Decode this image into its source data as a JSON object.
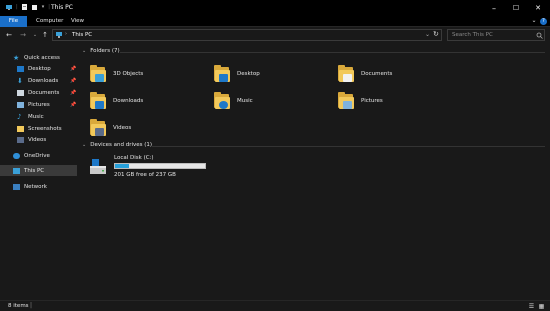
{
  "window": {
    "title": "This PC",
    "controls": {
      "minimize": "–",
      "maximize": "☐",
      "close": "✕"
    }
  },
  "ribbon": {
    "tabs": [
      "File",
      "Computer",
      "View"
    ],
    "expand_icon": "chevron-down-icon",
    "help_icon": "help-icon"
  },
  "address": {
    "path": "This PC",
    "search_placeholder": "Search This PC"
  },
  "sidebar": {
    "items": [
      {
        "label": "Quick access",
        "icon": "star-icon",
        "pinned": false
      },
      {
        "label": "Desktop",
        "icon": "desktop-icon",
        "pinned": true
      },
      {
        "label": "Downloads",
        "icon": "download-icon",
        "pinned": true
      },
      {
        "label": "Documents",
        "icon": "documents-icon",
        "pinned": true
      },
      {
        "label": "Pictures",
        "icon": "pictures-icon",
        "pinned": true
      },
      {
        "label": "Music",
        "icon": "music-icon",
        "pinned": false
      },
      {
        "label": "Screenshots",
        "icon": "folder-icon",
        "pinned": false
      },
      {
        "label": "Videos",
        "icon": "videos-icon",
        "pinned": false
      },
      {
        "label": "OneDrive",
        "icon": "cloud-icon",
        "pinned": false
      },
      {
        "label": "This PC",
        "icon": "computer-icon",
        "pinned": false,
        "selected": true
      },
      {
        "label": "Network",
        "icon": "network-icon",
        "pinned": false
      }
    ]
  },
  "main": {
    "folders_header": "Folders (7)",
    "folders": [
      {
        "label": "3D Objects",
        "badge_color": "#3aa0d8"
      },
      {
        "label": "Desktop",
        "badge_color": "#1e78c8"
      },
      {
        "label": "Documents",
        "badge_color": "#f2f2f2"
      },
      {
        "label": "Downloads",
        "badge_color": "#1e78c8"
      },
      {
        "label": "Music",
        "badge_color": "#1e78c8"
      },
      {
        "label": "Pictures",
        "badge_color": "#7fb2dc"
      },
      {
        "label": "Videos",
        "badge_color": "#5a6b8a"
      }
    ],
    "devices_header": "Devices and drives (1)",
    "drive": {
      "name": "Local Disk (C:)",
      "free_text": "201 GB free of 237 GB",
      "used_fraction": 0.15
    }
  },
  "status": {
    "item_count": "8 items"
  },
  "colors": {
    "accent": "#1a6fc9",
    "background": "#191919",
    "selection": "#3a3a3a",
    "folder": "#f2c95b"
  }
}
